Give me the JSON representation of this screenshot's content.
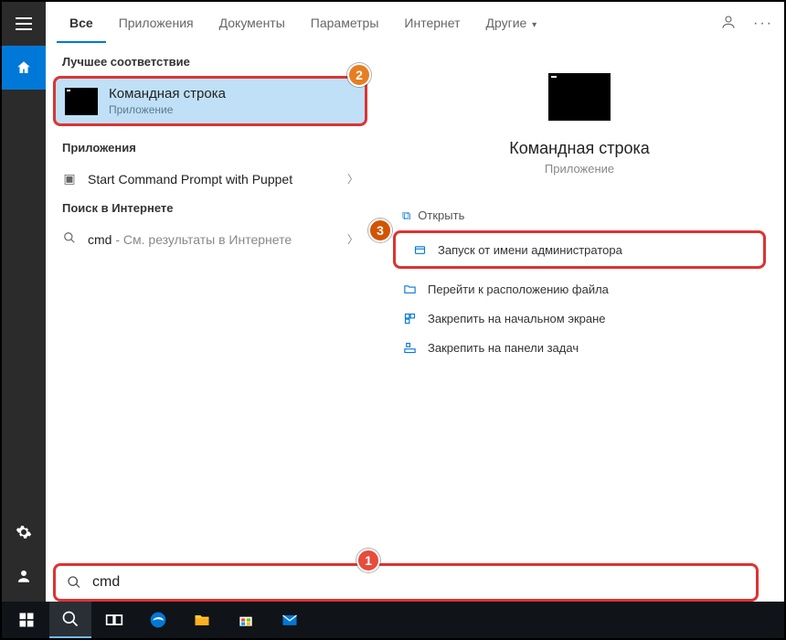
{
  "tabs": {
    "all": "Все",
    "apps": "Приложения",
    "docs": "Документы",
    "settings": "Параметры",
    "internet": "Интернет",
    "more": "Другие"
  },
  "sections": {
    "best": "Лучшее соответствие",
    "apps": "Приложения",
    "web": "Поиск в Интернете"
  },
  "bestMatch": {
    "title": "Командная строка",
    "subtitle": "Приложение"
  },
  "appsList": {
    "item1": "Start Command Prompt with Puppet"
  },
  "webList": {
    "query": "cmd",
    "hint": " - См. результаты в Интернете"
  },
  "preview": {
    "title": "Командная строка",
    "subtitle": "Приложение"
  },
  "actions": {
    "open": "Открыть",
    "runAdmin": "Запуск от имени администратора",
    "openLocation": "Перейти к расположению файла",
    "pinStart": "Закрепить на начальном экране",
    "pinTaskbar": "Закрепить на панели задач"
  },
  "search": {
    "value": "cmd"
  },
  "badges": {
    "b1": "1",
    "b2": "2",
    "b3": "3"
  },
  "topRight": {
    "more": "···"
  }
}
